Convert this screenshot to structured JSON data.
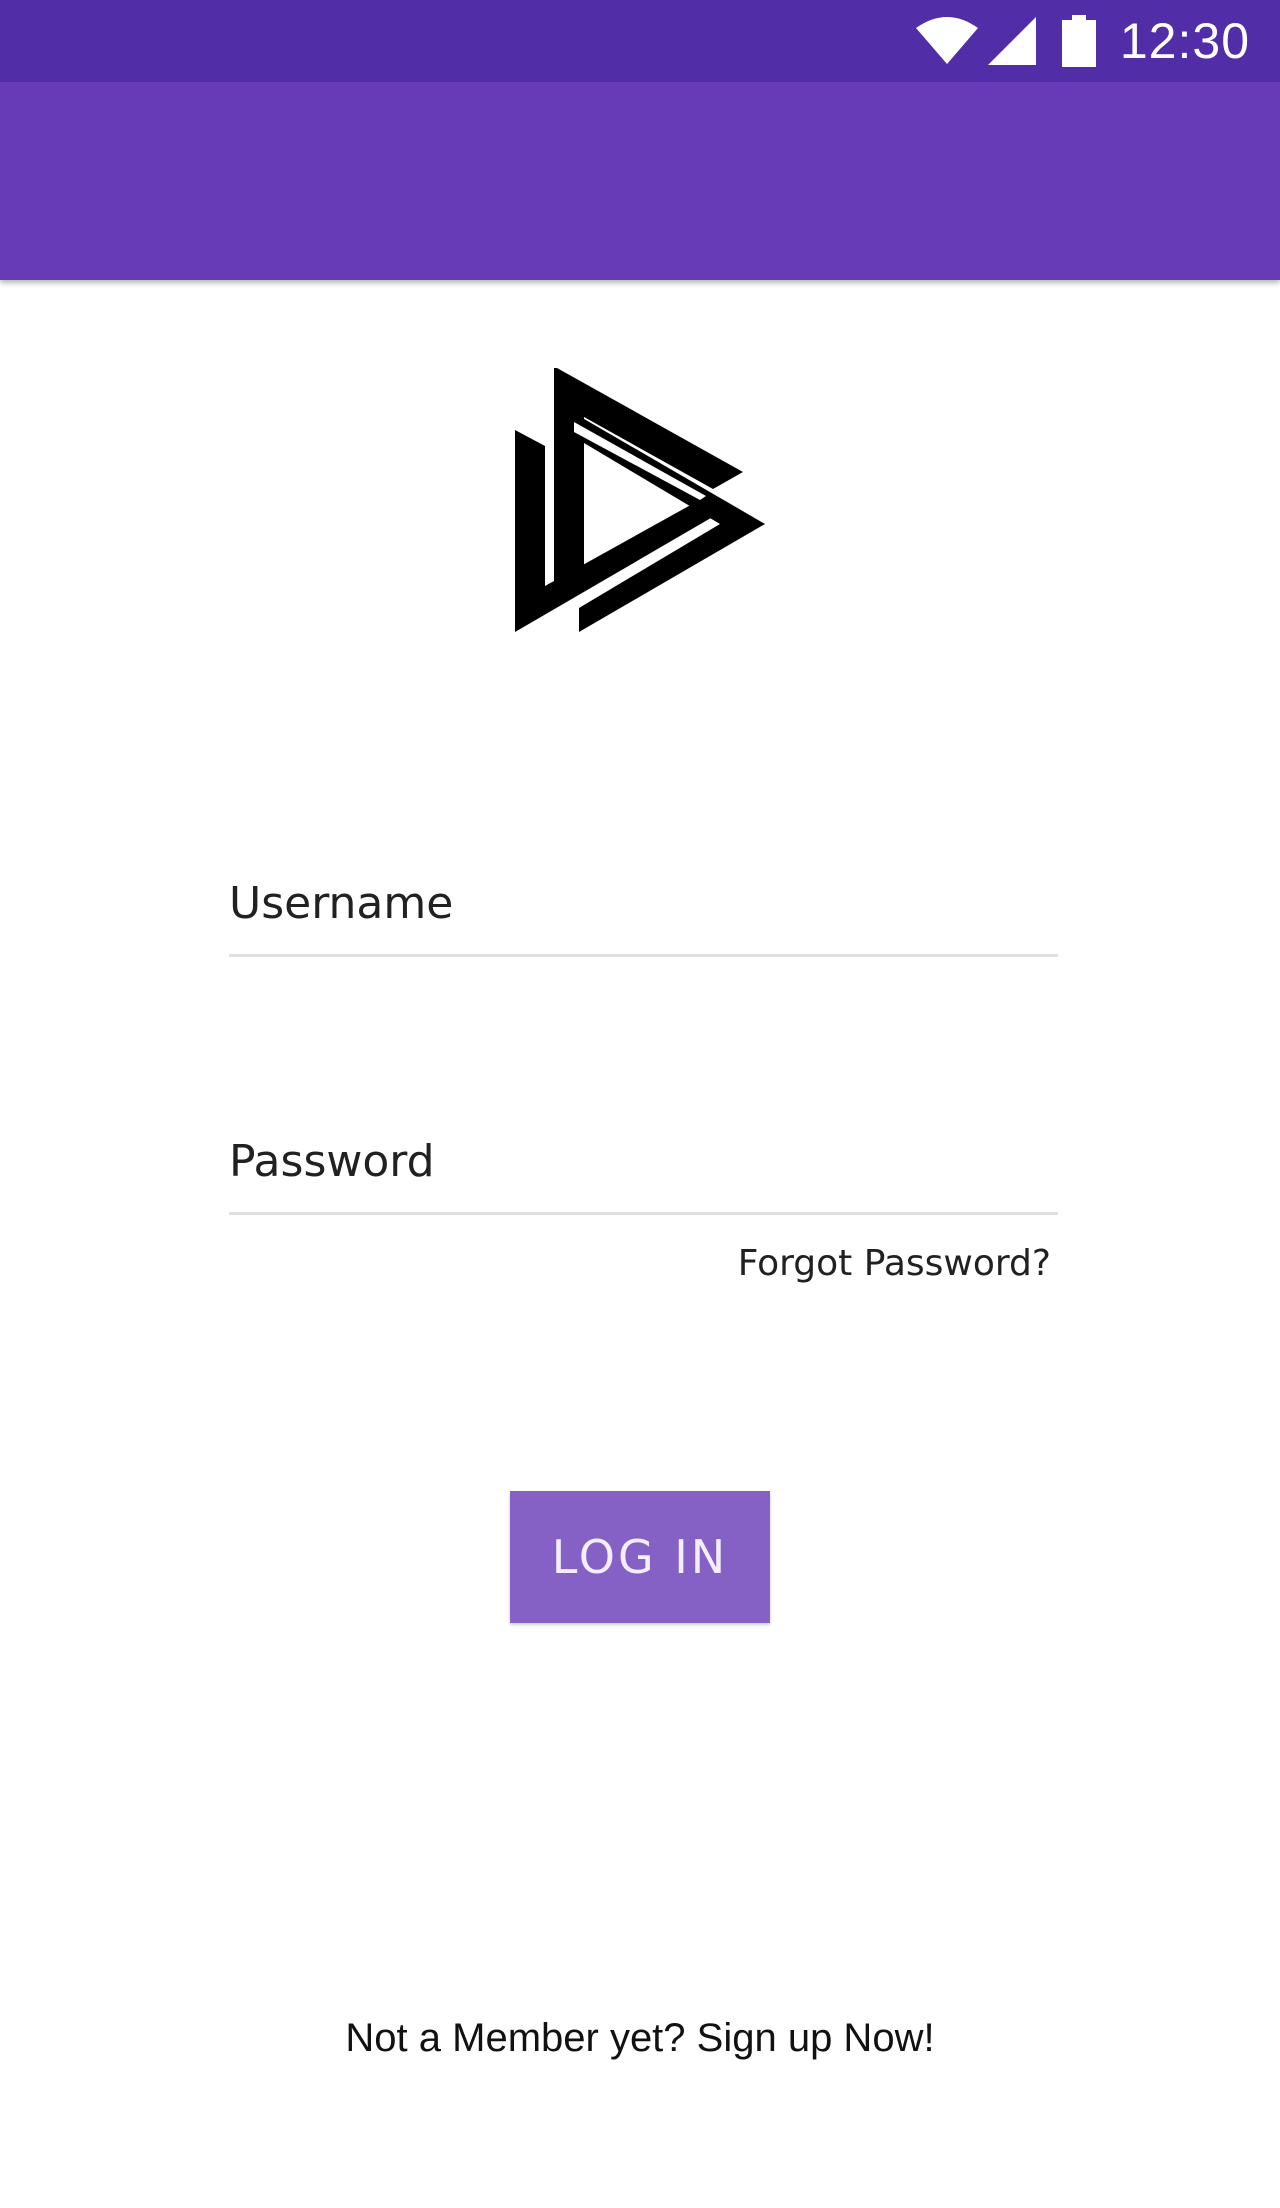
{
  "status_bar": {
    "time": "12:30",
    "icons": [
      "wifi-icon",
      "signal-icon",
      "battery-icon"
    ],
    "color": "#512da8"
  },
  "app_bar": {
    "color": "#673ab7"
  },
  "logo": {
    "icon": "triangle-play-logo-icon",
    "color": "#000000"
  },
  "form": {
    "username_placeholder": "Username",
    "password_placeholder": "Password",
    "forgot_password": "Forgot Password?",
    "login_label": "LOG IN",
    "login_color": "#8561c5"
  },
  "footer": {
    "signup_text": "Not a Member yet? Sign up Now!"
  }
}
